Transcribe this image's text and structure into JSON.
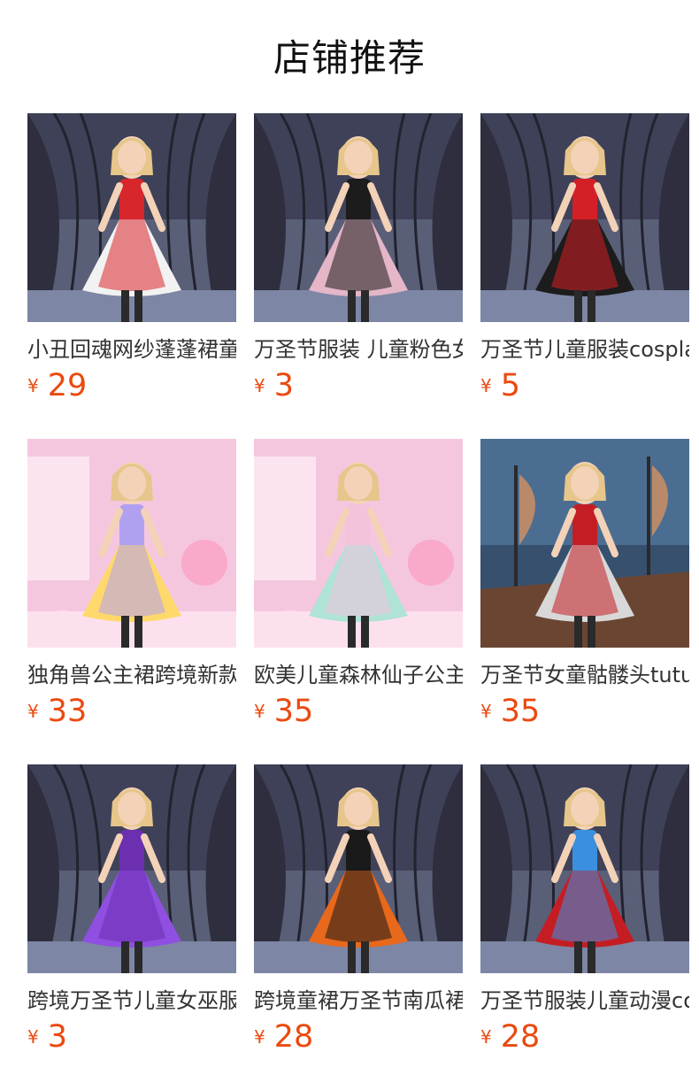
{
  "section_title": "店铺推荐",
  "currency_symbol": "¥",
  "accent_color": "#ea4a10",
  "products": [
    {
      "name": "小丑回魂网纱蓬蓬裙童装",
      "price": "29",
      "scene": "haunted",
      "dress": "#d8262d",
      "dress2": "#f2f2f2"
    },
    {
      "name": "万圣节服装 儿童粉色女巫",
      "price": "3",
      "scene": "haunted",
      "dress": "#1c1c1c",
      "dress2": "#e4b6c8"
    },
    {
      "name": "万圣节儿童服装cosplay",
      "price": "5",
      "scene": "haunted",
      "dress": "#d51f26",
      "dress2": "#1c1c1c"
    },
    {
      "name": "独角兽公主裙跨境新款",
      "price": "33",
      "scene": "pink",
      "dress": "#b0a0f0",
      "dress2": "#ffd86b"
    },
    {
      "name": "欧美儿童森林仙子公主",
      "price": "35",
      "scene": "pink",
      "dress": "#f3c3dc",
      "dress2": "#aee3d6"
    },
    {
      "name": "万圣节女童骷髅头tutu",
      "price": "35",
      "scene": "ship",
      "dress": "#c41e24",
      "dress2": "#d8d8d8"
    },
    {
      "name": "跨境万圣节儿童女巫服装",
      "price": "3",
      "scene": "haunted",
      "dress": "#6b2fb0",
      "dress2": "#8f4fe0"
    },
    {
      "name": "跨境童裙万圣节南瓜裙",
      "price": "28",
      "scene": "haunted",
      "dress": "#1a1a1a",
      "dress2": "#e8681c"
    },
    {
      "name": "万圣节服装儿童动漫cos",
      "price": "28",
      "scene": "haunted",
      "dress": "#3b8fe0",
      "dress2": "#c41e24"
    }
  ]
}
